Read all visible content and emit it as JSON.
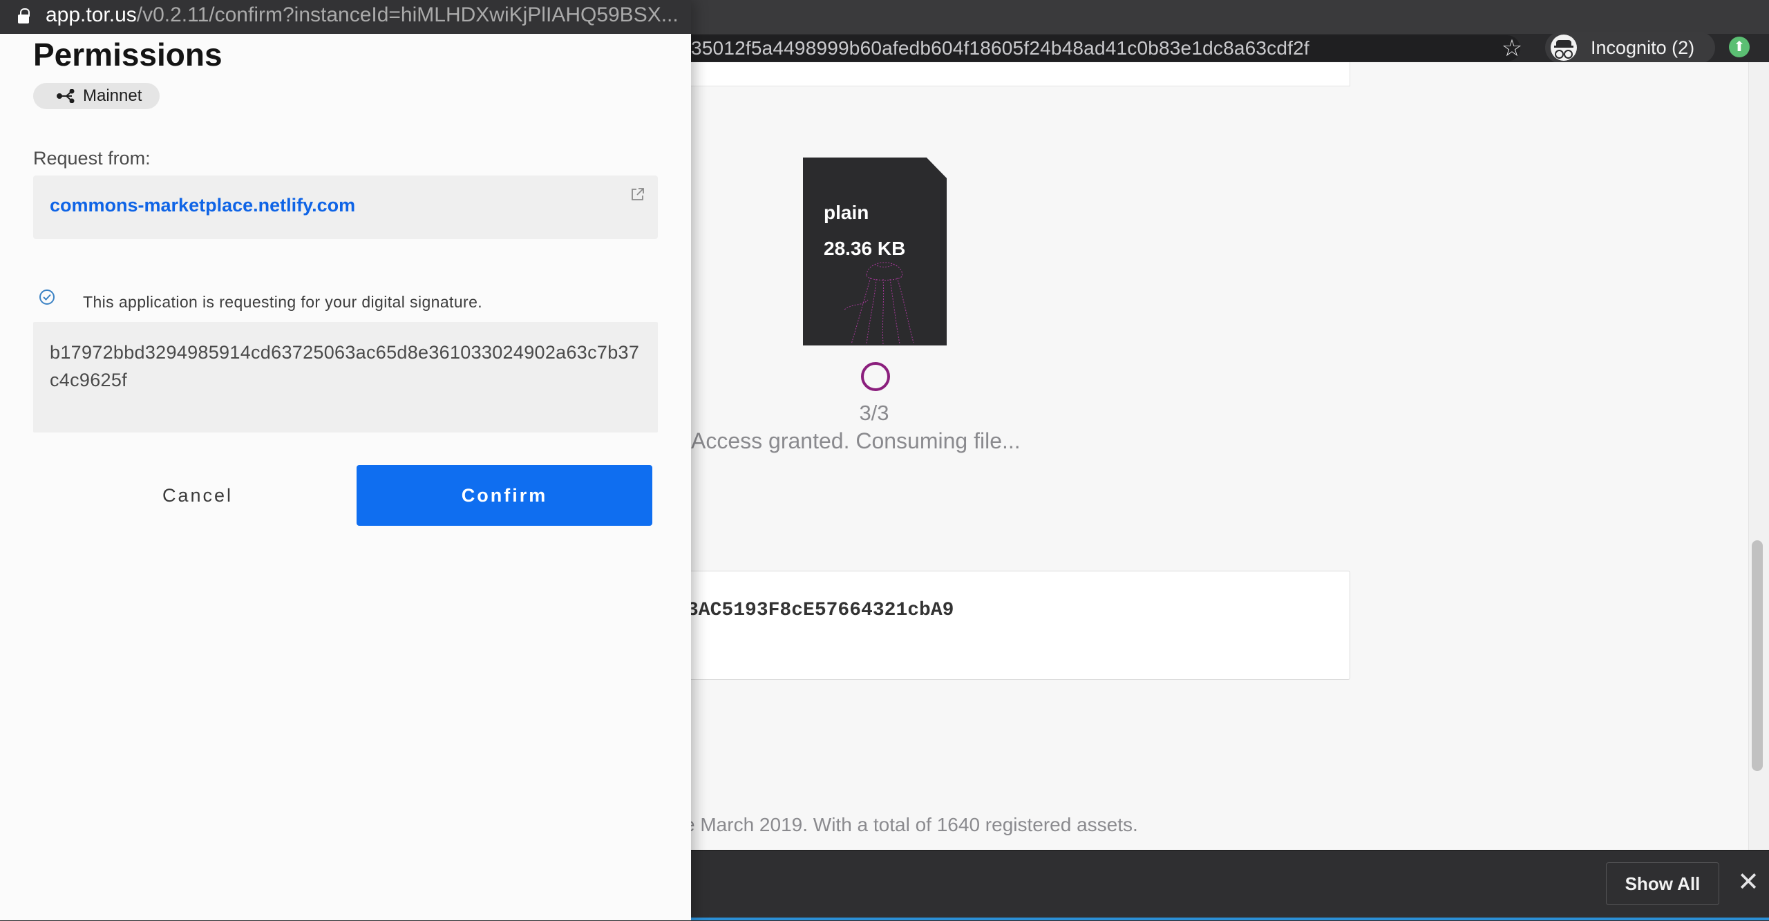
{
  "background_browser": {
    "url_fragment": "35012f5a4498999b60afedb604f18605f24b48ad41c0b83e1dc8a63cdf2f",
    "incognito_label": "Incognito (2)",
    "file": {
      "type": "plain",
      "size": "28.36 KB"
    },
    "progress": {
      "step": "3/3",
      "status": "Access granted. Consuming file..."
    },
    "address_partial": "3AC5193F8cE57664321cbA9",
    "footer_text": "e March 2019. With a total of 1640 registered assets.",
    "downloads_bar": {
      "show_all_label": "Show All"
    }
  },
  "popup": {
    "url_host": "app.tor.us",
    "url_path": "/v0.2.11/confirm?instanceId=hiMLHDXwiKjPlIAHQ59BSX...",
    "title": "Permissions",
    "network": "Mainnet",
    "request_label": "Request from:",
    "origin": "commons-marketplace.netlify.com",
    "signature_note": "This application is requesting for your digital signature.",
    "message": "b17972bbd3294985914cd63725063ac65d8e361033024902a63c7b37c4c9625f",
    "cancel_label": "Cancel",
    "confirm_label": "Confirm"
  },
  "colors": {
    "accent": "#0f6ef0",
    "link": "#0f64e6",
    "progress_ring": "#8b1f7d",
    "chrome_dark": "#2a2a2c"
  }
}
